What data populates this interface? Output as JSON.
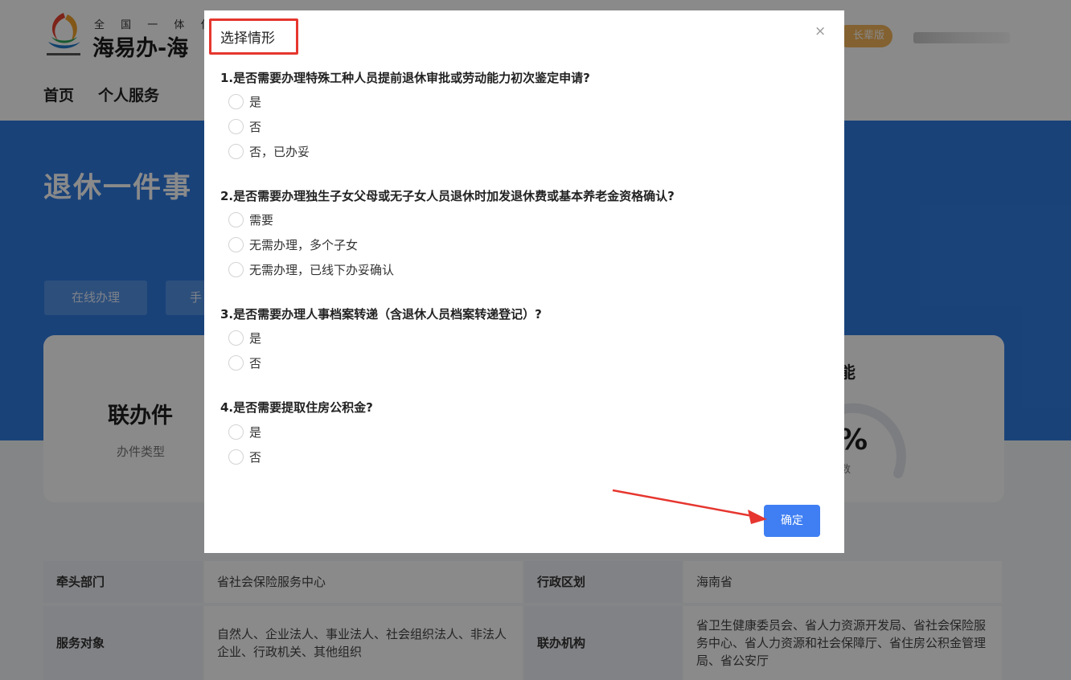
{
  "header": {
    "subtitle": "全 国 一 体 化 在",
    "site_title": "海易办-海",
    "elder_badge": "长辈版",
    "nav": [
      "首页",
      "个人服务"
    ]
  },
  "banner": {
    "title": "退休一件事",
    "btn_online": "在线办理",
    "btn_second": "手"
  },
  "card": {
    "value": "联办件",
    "value_label": "办件类型",
    "right_title": "能",
    "right_value": "%",
    "right_sub": "数"
  },
  "info": {
    "row1": {
      "key1": "牵头部门",
      "val1": "省社会保险服务中心",
      "key2": "行政区划",
      "val2": "海南省"
    },
    "row2": {
      "key1": "服务对象",
      "val1": "自然人、企业法人、事业法人、社会组织法人、非法人企业、行政机关、其他组织",
      "key2": "联办机构",
      "val2": "省卫生健康委员会、省人力资源开发局、省社会保险服务中心、省人力资源和社会保障厅、省住房公积金管理局、省公安厅"
    }
  },
  "modal": {
    "title": "选择情形",
    "close": "×",
    "confirm": "确定",
    "questions": [
      {
        "text": "1.是否需要办理特殊工种人员提前退休审批或劳动能力初次鉴定申请?",
        "options": [
          "是",
          "否",
          "否，已办妥"
        ]
      },
      {
        "text": "2.是否需要办理独生子女父母或无子女人员退休时加发退休费或基本养老金资格确认?",
        "options": [
          "需要",
          "无需办理，多个子女",
          "无需办理，已线下办妥确认"
        ]
      },
      {
        "text": "3.是否需要办理人事档案转递（含退休人员档案转递登记）?",
        "options": [
          "是",
          "否"
        ]
      },
      {
        "text": "4.是否需要提取住房公积金?",
        "options": [
          "是",
          "否"
        ]
      }
    ]
  },
  "colors": {
    "banner_blue": "#2f7be0",
    "primary_button": "#3f7ff3",
    "highlight_box": "#e6362f",
    "annotation_arrow": "#e6362f",
    "elder_badge": "#f2b35a"
  }
}
